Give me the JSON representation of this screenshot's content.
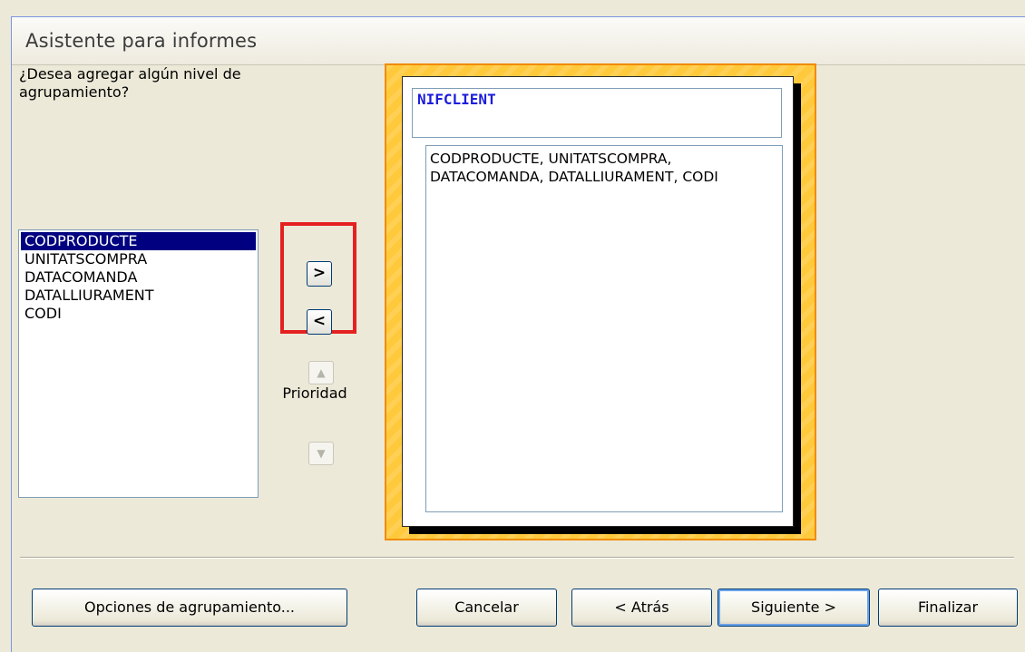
{
  "window": {
    "title": "Asistente para informes"
  },
  "prompt": {
    "question": "¿Desea agregar algún nivel de agrupamiento?"
  },
  "field_list": {
    "items": [
      "CODPRODUCTE",
      "UNITATSCOMPRA",
      "DATACOMANDA",
      "DATALLIURAMENT",
      "CODI"
    ],
    "selected": "CODPRODUCTE"
  },
  "arrows": {
    "add_label": ">",
    "remove_label": "<",
    "up_label": "▲",
    "down_label": "▼"
  },
  "priority": {
    "label": "Prioridad"
  },
  "preview": {
    "group_header": "NIFCLIENT",
    "detail_fields": "CODPRODUCTE, UNITATSCOMPRA, DATACOMANDA, DATALLIURAMENT, CODI"
  },
  "buttons": {
    "grouping_options": "Opciones de agrupamiento...",
    "cancel": "Cancelar",
    "back": "< Atrás",
    "next": "Siguiente >",
    "finish": "Finalizar"
  },
  "colors": {
    "highlight": "#e52020",
    "preview_frame": "#ffc93c",
    "group_text": "#1c1cdc",
    "selection": "#000080"
  }
}
